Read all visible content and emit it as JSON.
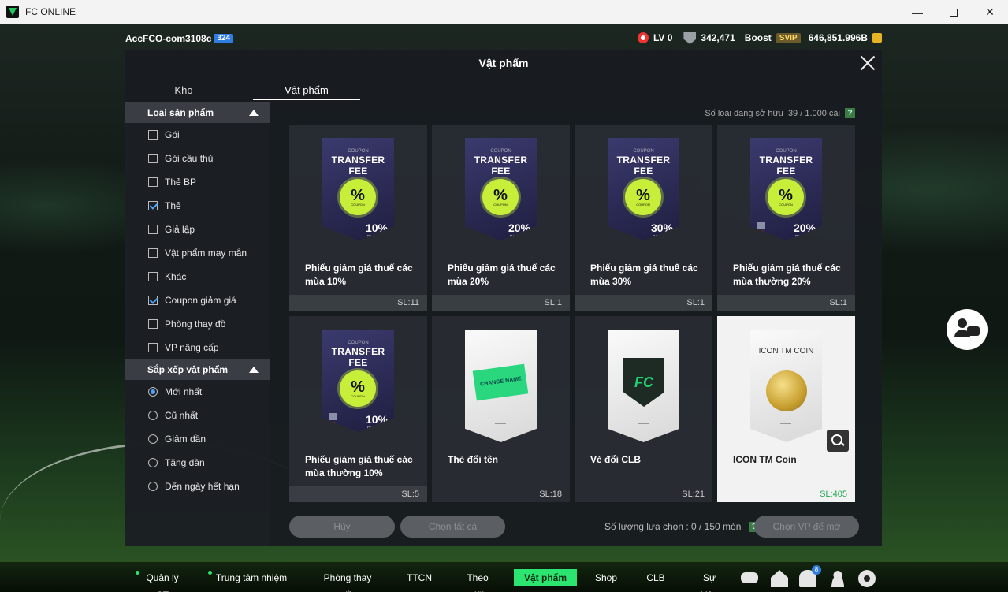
{
  "window": {
    "title": "FC ONLINE",
    "minimize": "—",
    "close": "✕"
  },
  "account": {
    "name": "AccFCO-com3108c",
    "badge": "324"
  },
  "stats": {
    "level": "LV 0",
    "points": "342,471",
    "boost": "Boost",
    "svip": "SVIP",
    "coins": "646,851.996B"
  },
  "modal": {
    "title": "Vật phẩm",
    "tabs": [
      {
        "label": "Kho"
      },
      {
        "label": "Vật phẩm"
      }
    ],
    "owned_label": "Số loại đang sở hữu",
    "owned_value": "39 / 1.000 cái",
    "help": "?"
  },
  "sidebar": {
    "category_title": "Loại sản phẩm",
    "categories": [
      {
        "label": "Gói",
        "checked": false
      },
      {
        "label": "Gói cầu thủ",
        "checked": false
      },
      {
        "label": "Thẻ BP",
        "checked": false
      },
      {
        "label": "Thẻ",
        "checked": true
      },
      {
        "label": "Giả lập",
        "checked": false
      },
      {
        "label": "Vật phẩm may mắn",
        "checked": false
      },
      {
        "label": "Khác",
        "checked": false
      },
      {
        "label": "Coupon giảm giá",
        "checked": true
      },
      {
        "label": "Phòng thay đồ",
        "checked": false
      },
      {
        "label": "VP nâng cấp",
        "checked": false
      }
    ],
    "sort_title": "Sắp xếp vật phẩm",
    "sorts": [
      {
        "label": "Mới nhất",
        "checked": true
      },
      {
        "label": "Cũ nhất",
        "checked": false
      },
      {
        "label": "Giảm dần",
        "checked": false
      },
      {
        "label": "Tăng dần",
        "checked": false
      },
      {
        "label": "Đến ngày hết hạn",
        "checked": false
      }
    ]
  },
  "items": [
    {
      "name": "Phiếu giảm giá thuế các mùa 10%",
      "qty": "SL:11",
      "kind": "coupon",
      "coupon_small": "COUPON",
      "coupon_title": "TRANSFER FEE",
      "badge": "%",
      "badge_sub": "COUPON",
      "discount": "10%",
      "discount_sub": "DISCOUNT",
      "restricted": false
    },
    {
      "name": "Phiếu giảm giá thuế các mùa 20%",
      "qty": "SL:1",
      "kind": "coupon",
      "coupon_small": "COUPON",
      "coupon_title": "TRANSFER FEE",
      "badge": "%",
      "badge_sub": "COUPON",
      "discount": "20%",
      "discount_sub": "DISCOUNT",
      "restricted": false
    },
    {
      "name": "Phiếu giảm giá thuế các mùa 30%",
      "qty": "SL:1",
      "kind": "coupon",
      "coupon_small": "COUPON",
      "coupon_title": "TRANSFER FEE",
      "badge": "%",
      "badge_sub": "COUPON",
      "discount": "30%",
      "discount_sub": "DISCOUNT",
      "restricted": false
    },
    {
      "name": "Phiếu giảm giá thuế các mùa thường 20%",
      "qty": "SL:1",
      "kind": "coupon",
      "coupon_small": "COUPON",
      "coupon_title": "TRANSFER FEE",
      "badge": "%",
      "badge_sub": "COUPON",
      "discount": "20%",
      "discount_sub": "DISCOUNT",
      "restricted": true
    },
    {
      "name": "Phiếu giảm giá thuế các mùa thường 10%",
      "qty": "SL:5",
      "kind": "coupon",
      "coupon_small": "COUPON",
      "coupon_title": "TRANSFER FEE",
      "badge": "%",
      "badge_sub": "COUPON",
      "discount": "10%",
      "discount_sub": "DISCOUNT",
      "restricted": true
    },
    {
      "name": "Thẻ đổi tên",
      "qty": "SL:18",
      "kind": "rename",
      "tag_text": "CHANGE NAME"
    },
    {
      "name": "Vé đổi CLB",
      "qty": "SL:21",
      "kind": "club",
      "logo_text": "FC"
    },
    {
      "name": "ICON TM Coin",
      "qty": "SL:405",
      "kind": "coin",
      "coin_title": "ICON TM COIN",
      "selected": true
    }
  ],
  "footer": {
    "cancel": "Hủy",
    "select_all": "Chọn tất cả",
    "select_count_label": "Số lượng lựa chọn : 0 / 150 món",
    "help": "?",
    "open": "Chọn VP để mở"
  },
  "bottom_nav": [
    {
      "label": "Quản lý CT",
      "dot": true
    },
    {
      "label": "Trung tâm nhiệm vụ",
      "dot": true
    },
    {
      "label": "Phòng thay đồ",
      "dot": false
    },
    {
      "label": "TTCN",
      "dot": false
    },
    {
      "label": "Theo dõi",
      "dot": false
    },
    {
      "label": "Vật phẩm",
      "dot": false,
      "active": true
    },
    {
      "label": "Shop",
      "dot": false
    },
    {
      "label": "CLB",
      "dot": false
    },
    {
      "label": "Sự kiện",
      "dot": false
    }
  ],
  "nav_badges": {
    "home": "2",
    "bell": "8"
  },
  "colors": {
    "accent": "#2ce570",
    "blue": "#2f7de1",
    "badge_lime": "#c7ef3a"
  }
}
